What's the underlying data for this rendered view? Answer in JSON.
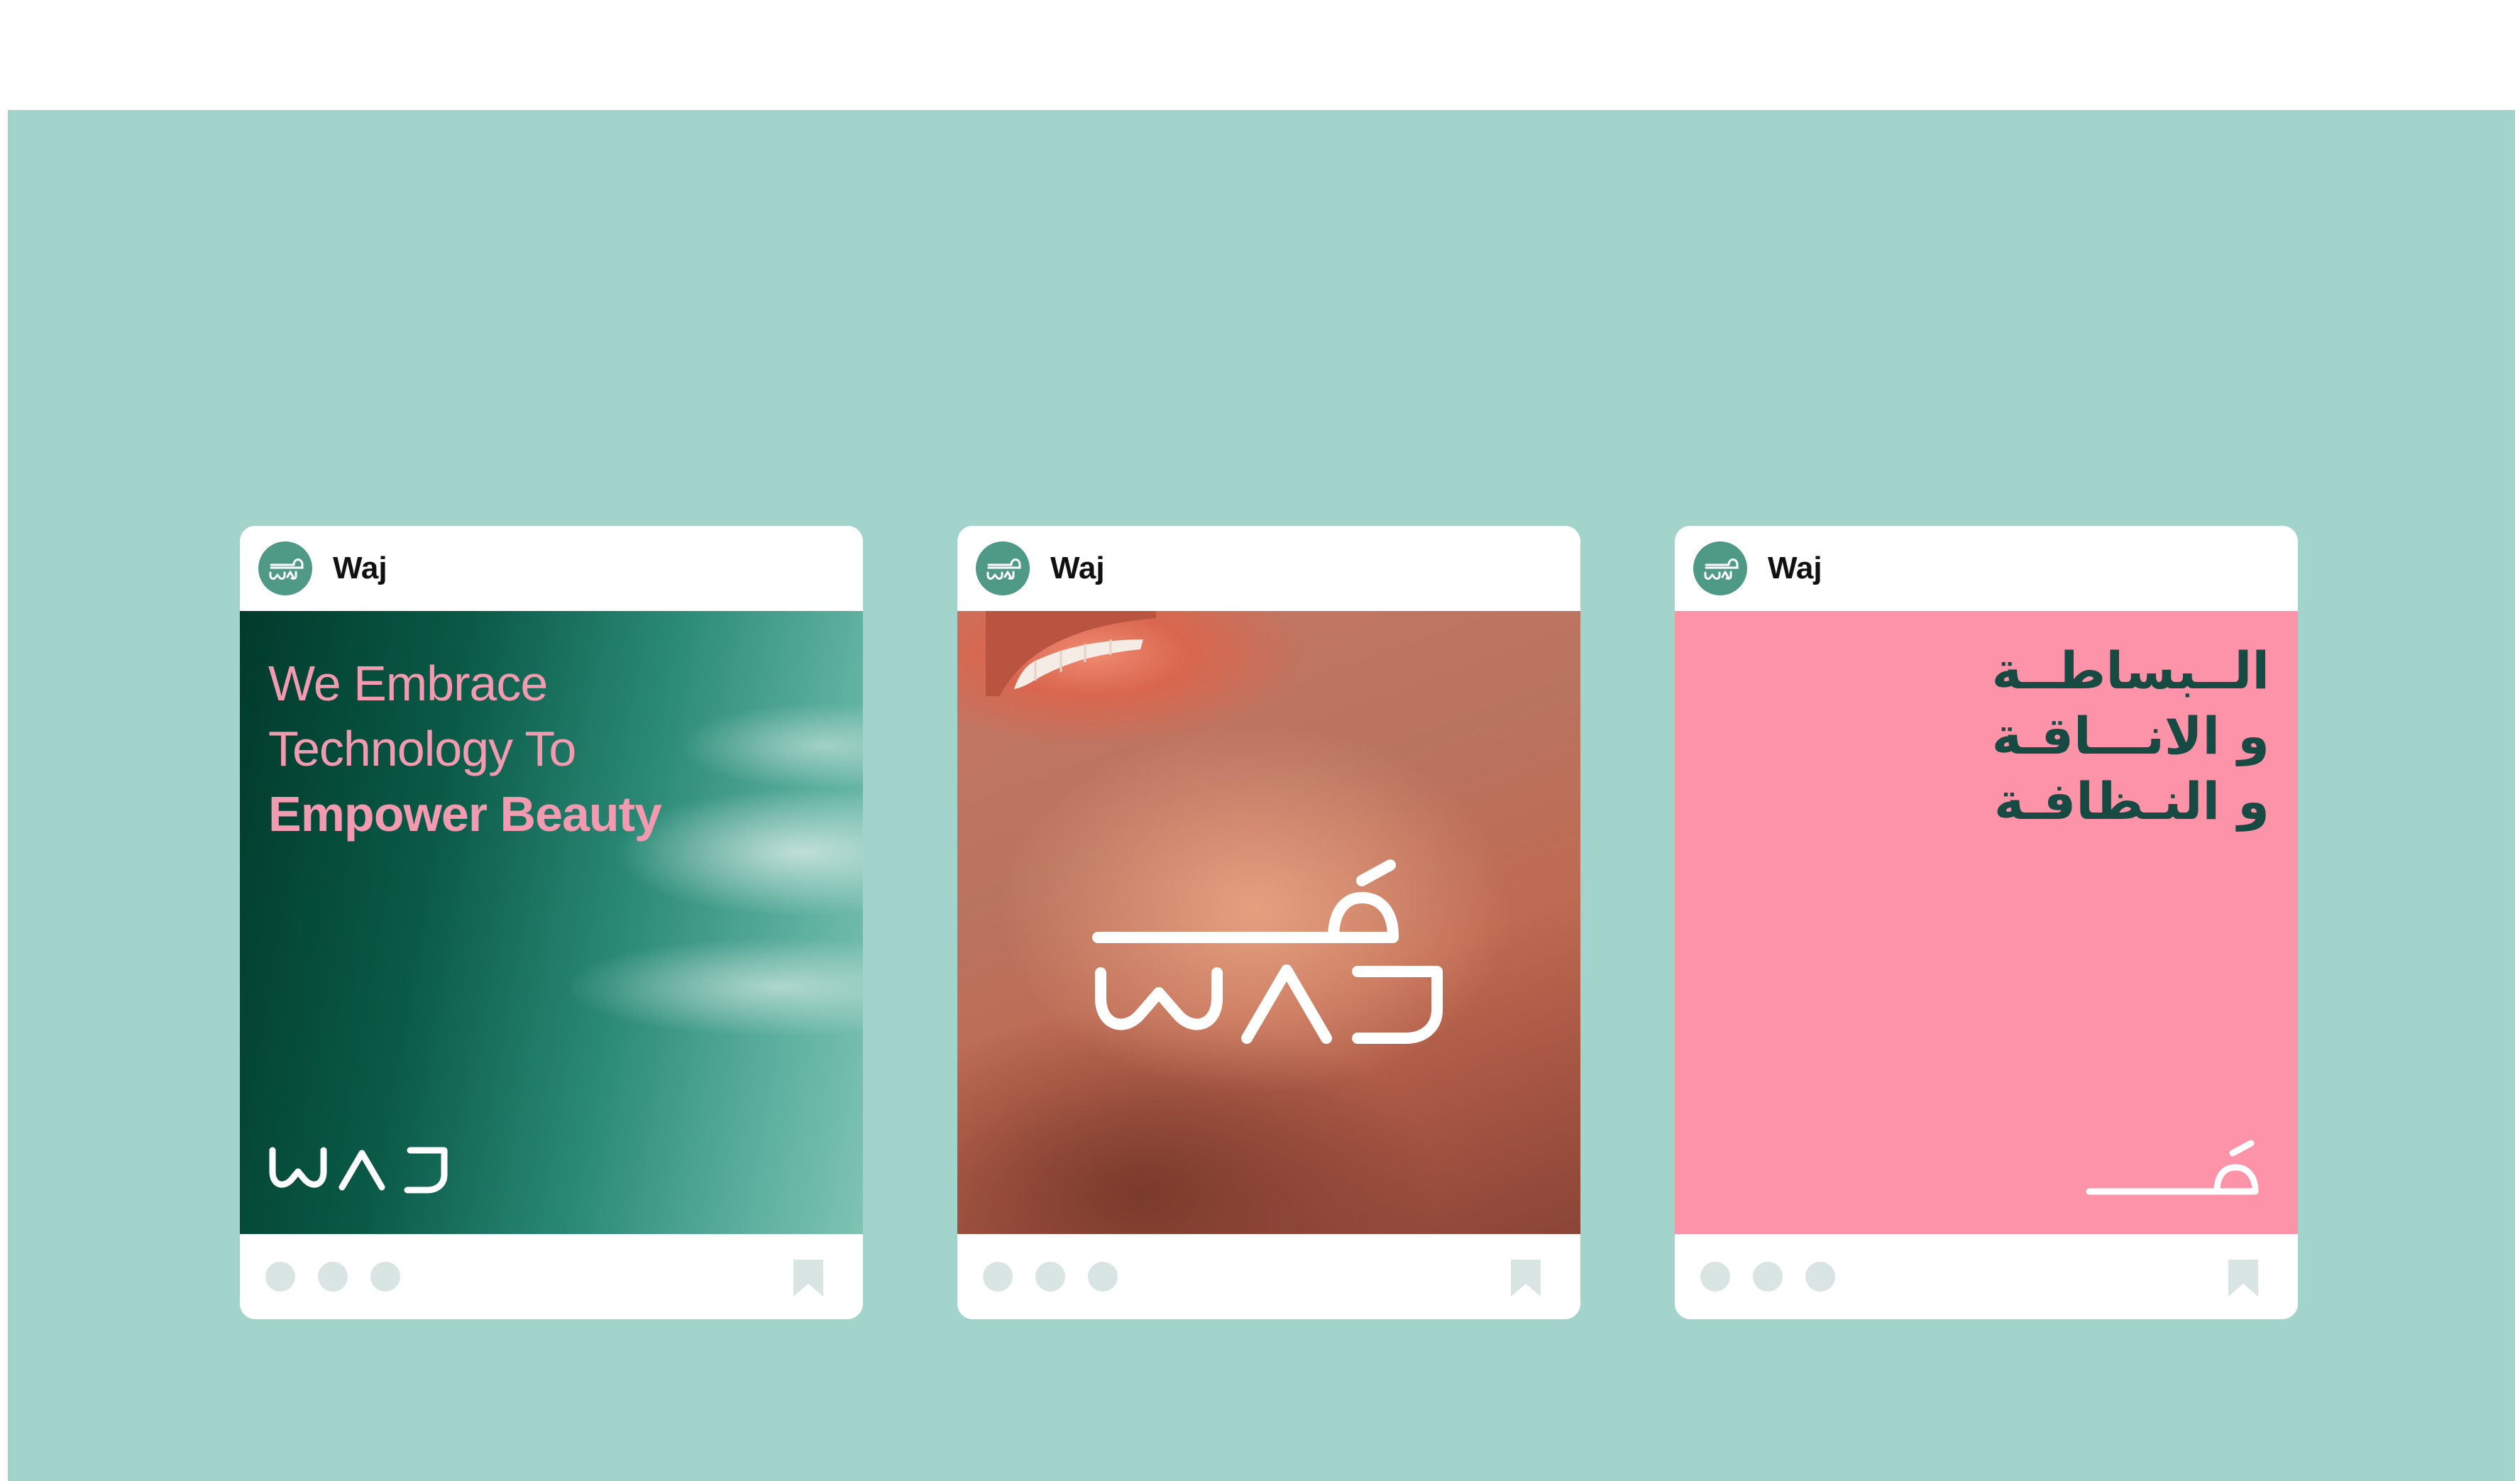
{
  "colors": {
    "stage_background": "#a3d4cc",
    "brand_green": "#4f9987",
    "brand_pink": "#fc93a9",
    "tagline_pink": "#f29bb0",
    "arabic_text": "#164a43",
    "footer_dots": "#d9e5e2"
  },
  "posts": [
    {
      "username": "Waj",
      "avatar_icon": "waj-logo-icon",
      "tagline": {
        "line1": "We Embrace",
        "line2": "Technology To",
        "line3": "Empower Beauty"
      },
      "logo": "waj-wordmark-latin",
      "logo_text": "waj",
      "footer_icons": [
        "dot-icon",
        "dot-icon",
        "dot-icon",
        "bookmark-icon"
      ]
    },
    {
      "username": "Waj",
      "avatar_icon": "waj-logo-icon",
      "image": "lips-closeup-photo",
      "logo": "waj-bilingual-logo",
      "logo_text": "waj",
      "footer_icons": [
        "dot-icon",
        "dot-icon",
        "dot-icon",
        "bookmark-icon"
      ]
    },
    {
      "username": "Waj",
      "avatar_icon": "waj-logo-icon",
      "arabic_lines": [
        "الــبساطــة",
        "و الانـــاقـة",
        "و النـظافـة"
      ],
      "logo": "waj-wordmark-arabic",
      "footer_icons": [
        "dot-icon",
        "dot-icon",
        "dot-icon",
        "bookmark-icon"
      ]
    }
  ]
}
